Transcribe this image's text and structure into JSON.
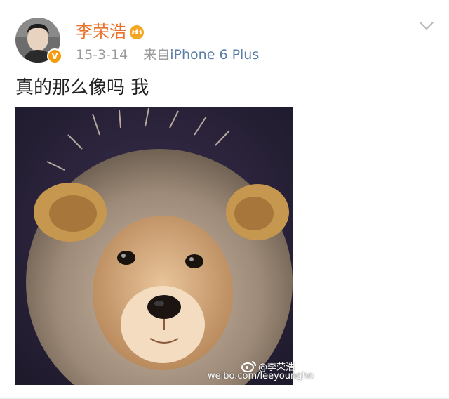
{
  "post": {
    "author": "李荣浩",
    "date": "15-3-14",
    "source_prefix": "来自",
    "source_device": "iPhone 6 Plus",
    "text": "真的那么像吗 我",
    "verified_badge": "V"
  },
  "watermark": {
    "handle": "@李荣浩",
    "url": "weibo.com/leeyoungho"
  },
  "icons": [
    "avatar",
    "verified-v-icon",
    "crown-icon",
    "chevron-down-icon",
    "weibo-logo-icon"
  ],
  "colors": {
    "author": "#e8722b",
    "meta": "#9a9a9a",
    "source": "#5b7da6",
    "badge": "#f39c12"
  }
}
